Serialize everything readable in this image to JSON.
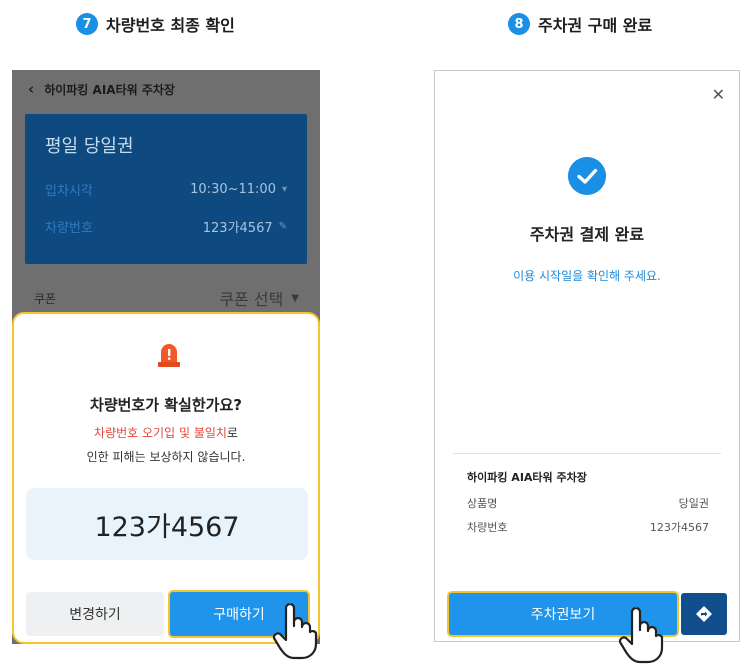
{
  "steps": [
    {
      "number": "7",
      "title": "차량번호 최종 확인"
    },
    {
      "number": "8",
      "title": "주차권 구매 완료"
    }
  ],
  "left_screen": {
    "header": {
      "back_icon": "chevron-left-icon",
      "title": "하이파킹 AIA타워 주차장"
    },
    "card": {
      "title": "평일 당일권",
      "entry_label": "입차시각",
      "entry_value": "10:30~11:00",
      "car_label": "차량번호",
      "car_value": "123가4567"
    },
    "coupon": {
      "label": "쿠폰",
      "select_label": "쿠폰 선택"
    },
    "modal": {
      "icon": "siren-alert-icon",
      "question": "차량번호가 확실한가요?",
      "warning_red": "차량번호 오기입 및 불일치",
      "warning_suffix": "로",
      "warning_line2": "인한 피해는 보상하지 않습니다.",
      "plate": "123가4567",
      "change_button": "변경하기",
      "buy_button": "구매하기"
    }
  },
  "right_screen": {
    "close_icon": "close-icon",
    "check_icon": "check-circle-icon",
    "title": "주차권 결제 완료",
    "subtitle": "이용 시작일을 확인해 주세요.",
    "lot_name": "하이파킹 AIA타워 주차장",
    "product_label": "상품명",
    "product_value": "당일권",
    "car_label": "차량번호",
    "car_value": "123가4567",
    "view_button": "주차권보기",
    "nav_icon": "navigation-diamond-icon"
  },
  "colors": {
    "accent_blue": "#1f94ea",
    "highlight_yellow": "#f3c52c",
    "warning_red": "#e2483d",
    "card_navy": "#0e4a80"
  }
}
